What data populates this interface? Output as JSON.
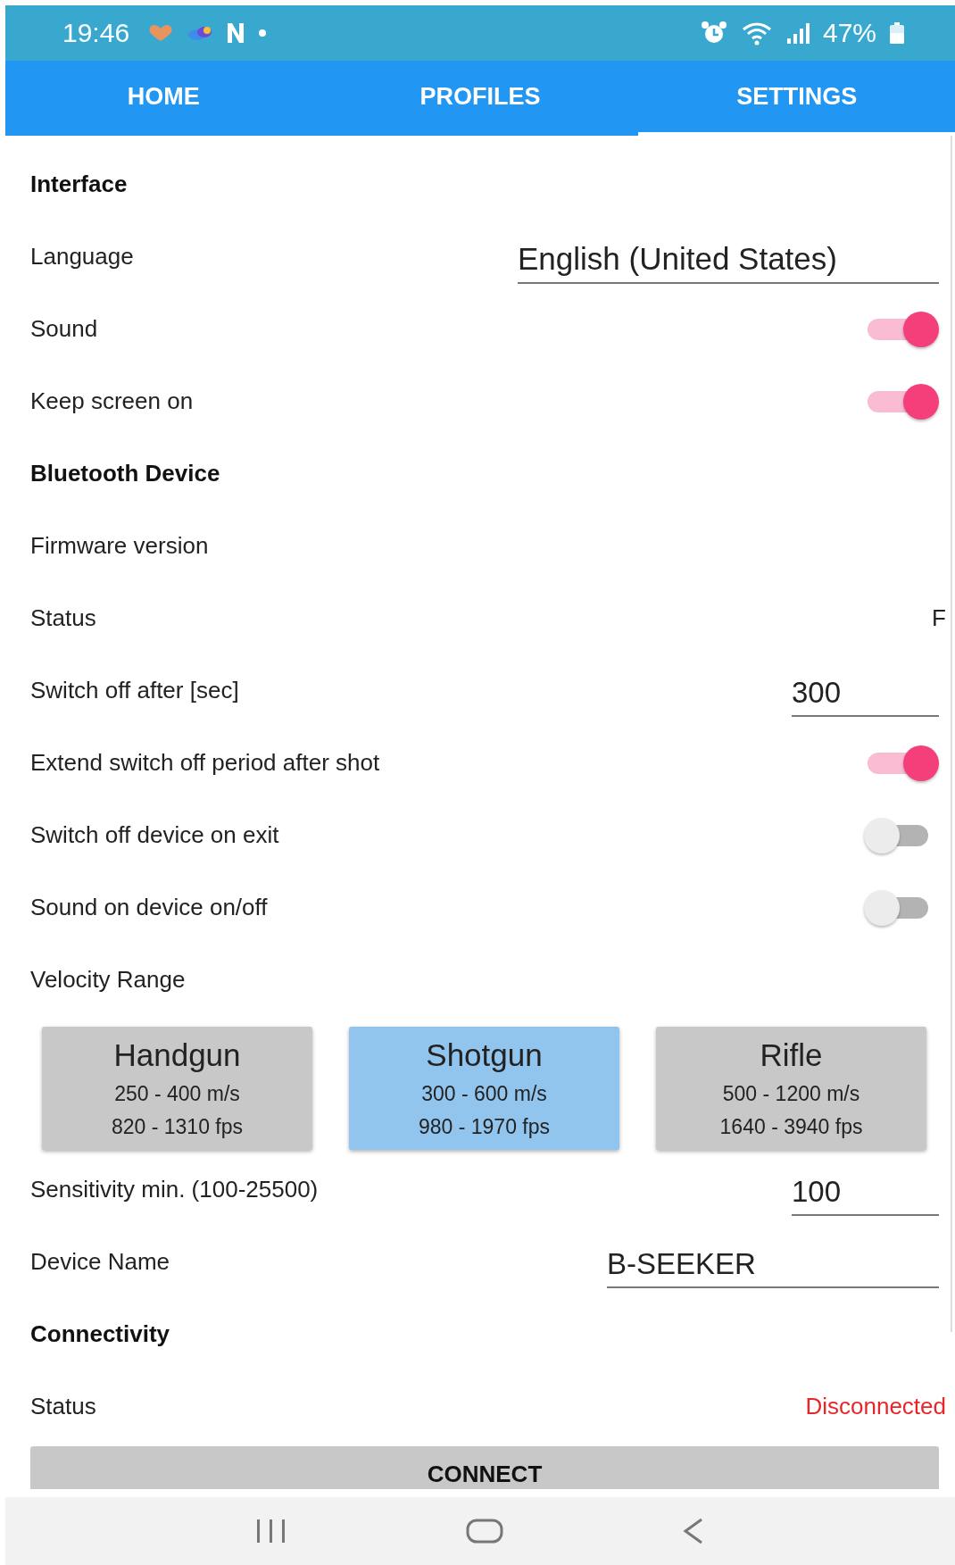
{
  "status_bar": {
    "time": "19:46",
    "battery": "47%"
  },
  "tabs": [
    {
      "label": "HOME",
      "selected": false
    },
    {
      "label": "PROFILES",
      "selected": false
    },
    {
      "label": "SETTINGS",
      "selected": true
    }
  ],
  "settings": [
    {
      "kind": "heading",
      "label": "Interface"
    },
    {
      "kind": "select",
      "label": "Language",
      "value": "English (United States)"
    },
    {
      "kind": "toggle",
      "label": "Sound",
      "on": true
    },
    {
      "kind": "toggle",
      "label": "Keep screen on",
      "on": true
    },
    {
      "kind": "heading",
      "label": "Bluetooth Device"
    },
    {
      "kind": "text",
      "label": "Firmware version"
    },
    {
      "kind": "value",
      "label": "Status",
      "value": "F"
    },
    {
      "kind": "input",
      "label": "Switch off after [sec]",
      "value": "300"
    },
    {
      "kind": "toggle",
      "label": "Extend switch off period after shot",
      "on": true
    },
    {
      "kind": "toggle",
      "label": "Switch off device on exit",
      "on": false
    },
    {
      "kind": "toggle",
      "label": "Sound on device on/off",
      "on": false
    },
    {
      "kind": "text",
      "label": "Velocity Range"
    },
    {
      "kind": "ranges",
      "options": [
        {
          "title": "Handgun",
          "metric": "250 - 400 m/s",
          "imperial": "820 - 1310 fps",
          "selected": false
        },
        {
          "title": "Shotgun",
          "metric": "300 - 600 m/s",
          "imperial": "980 - 1970 fps",
          "selected": true
        },
        {
          "title": "Rifle",
          "metric": "500 - 1200 m/s",
          "imperial": "1640 - 3940 fps",
          "selected": false
        }
      ]
    },
    {
      "kind": "input",
      "label": "Sensitivity min. (100-25500)",
      "value": "100"
    },
    {
      "kind": "wideinput",
      "label": "Device Name",
      "value": "B-SEEKER"
    },
    {
      "kind": "heading",
      "label": "Connectivity"
    },
    {
      "kind": "alert",
      "label": "Status",
      "value": "Disconnected"
    },
    {
      "kind": "button",
      "label": "CONNECT"
    }
  ]
}
